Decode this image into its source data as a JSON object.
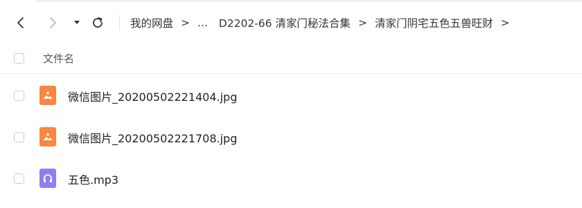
{
  "nav": {
    "back_icon": "chevron-left-icon",
    "forward_icon": "chevron-right-icon",
    "history_icon": "caret-down-icon",
    "refresh_icon": "refresh-icon"
  },
  "breadcrumb": {
    "items": [
      "我的网盘",
      "...",
      "D2202-66 清家门秘法合集",
      "清家门阴宅五色五兽旺财"
    ],
    "separator": ">"
  },
  "list": {
    "header_label": "文件名",
    "files": [
      {
        "name": "微信图片_20200502221404.jpg",
        "type": "image",
        "icon": "image-file-icon"
      },
      {
        "name": "微信图片_20200502221708.jpg",
        "type": "image",
        "icon": "image-file-icon"
      },
      {
        "name": "五色.mp3",
        "type": "audio",
        "icon": "audio-file-icon"
      }
    ]
  },
  "colors": {
    "image_icon": "#fa8640",
    "audio_icon": "#8c7ff2",
    "text": "#333333"
  }
}
